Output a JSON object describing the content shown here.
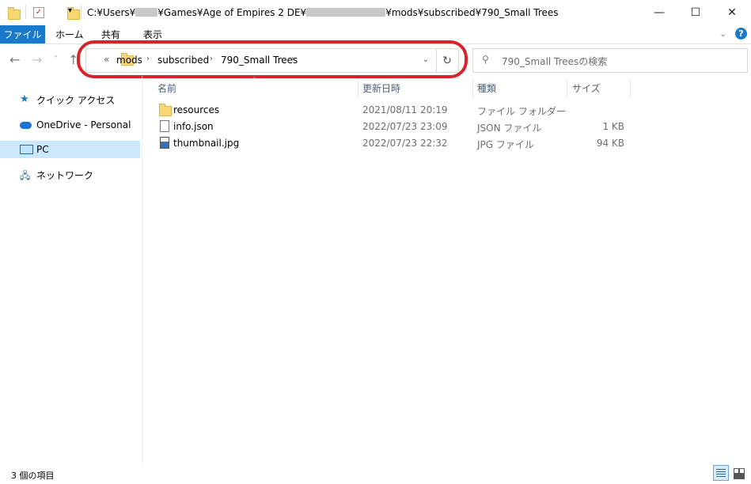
{
  "window": {
    "path_prefix": "C:¥Users¥",
    "path_mid": "¥Games¥Age of Empires 2 DE¥",
    "path_suffix": "¥mods¥subscribed¥790_Small Trees",
    "minimize": "—",
    "maximize": "☐",
    "close": "✕"
  },
  "ribbon": {
    "tabs": [
      "ファイル",
      "ホーム",
      "共有",
      "表示"
    ],
    "help": "?"
  },
  "nav": {
    "breadcrumb": [
      "mods",
      "subscribed",
      "790_Small Trees"
    ],
    "overflow": "«",
    "search_placeholder": "790_Small Treesの検索"
  },
  "sidebar": {
    "items": [
      "クイック アクセス",
      "OneDrive - Personal",
      "PC",
      "ネットワーク"
    ]
  },
  "columns": [
    "名前",
    "更新日時",
    "種類",
    "サイズ"
  ],
  "files": [
    {
      "name": "resources",
      "modified": "2021/08/11 20:19",
      "type": "ファイル フォルダー",
      "size": "",
      "icon": "folder-icon"
    },
    {
      "name": "info.json",
      "modified": "2022/07/23 23:09",
      "type": "JSON ファイル",
      "size": "1 KB",
      "icon": "file-icon"
    },
    {
      "name": "thumbnail.jpg",
      "modified": "2022/07/23 22:32",
      "type": "JPG ファイル",
      "size": "94 KB",
      "icon": "image-file-icon"
    }
  ],
  "status": {
    "item_count": "3 個の項目"
  },
  "colors": {
    "accent": "#1979ca",
    "highlight_ring": "#d8232a",
    "selected": "#cce8ff"
  }
}
